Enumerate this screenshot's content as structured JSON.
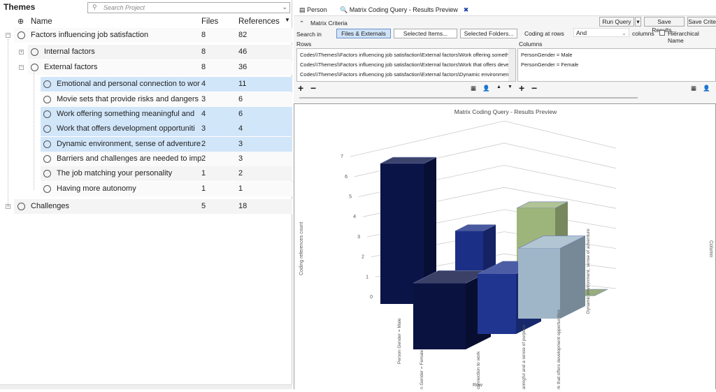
{
  "themes": {
    "title": "Themes",
    "search_placeholder": "Search Project",
    "columns": {
      "name": "Name",
      "files": "Files",
      "references": "References"
    },
    "rows": [
      {
        "name": "Factors influencing job satisfaction",
        "files": "8",
        "references": "82",
        "level": 0,
        "expander": "minus",
        "selected": false
      },
      {
        "name": "Internal factors",
        "files": "8",
        "references": "46",
        "level": 1,
        "expander": "plus",
        "selected": false
      },
      {
        "name": "External factors",
        "files": "8",
        "references": "36",
        "level": 1,
        "expander": "minus",
        "selected": false
      },
      {
        "name": "Emotional and personal connection to wor",
        "files": "4",
        "references": "11",
        "level": 2,
        "selected": true
      },
      {
        "name": "Movie sets that provide risks and dangers",
        "files": "3",
        "references": "6",
        "level": 2,
        "selected": false
      },
      {
        "name": "Work offering something meaningful and",
        "files": "4",
        "references": "6",
        "level": 2,
        "selected": true
      },
      {
        "name": "Work that offers development opportuniti",
        "files": "3",
        "references": "4",
        "level": 2,
        "selected": true
      },
      {
        "name": "Dynamic environment, sense of adventure",
        "files": "2",
        "references": "3",
        "level": 2,
        "selected": true
      },
      {
        "name": "Barriers and challenges are needed to imp",
        "files": "2",
        "references": "3",
        "level": 2,
        "selected": false
      },
      {
        "name": "The job matching your personality",
        "files": "1",
        "references": "2",
        "level": 2,
        "selected": false
      },
      {
        "name": "Having more autonomy",
        "files": "1",
        "references": "1",
        "level": 2,
        "selected": false
      },
      {
        "name": "Challenges",
        "files": "5",
        "references": "18",
        "level": 0,
        "expander": "plus",
        "selected": false
      }
    ]
  },
  "tabs": [
    {
      "label": "Person"
    },
    {
      "label": "Matrix Coding Query - Results Preview"
    }
  ],
  "criteria": {
    "section": "Matrix Criteria",
    "run_query": "Run Query",
    "save_results": "Save Results...",
    "save_criteria": "Save Criter",
    "search_in": "Search in",
    "files_externals": "Files & Externals",
    "selected_items": "Selected Items...",
    "selected_folders": "Selected Folders...",
    "coding_at_rows": "Coding at rows",
    "operator": "And",
    "columns_label": "columns",
    "hierarchical_name": "Hierarchical Name",
    "rows_label": "Rows",
    "columns_header": "Columns",
    "rows": [
      "Codes\\\\Themes\\\\Factors influencing job satisfaction\\External factors\\Work offering somethi",
      "Codes\\\\Themes\\\\Factors influencing job satisfaction\\External factors\\Work that offers devel",
      "Codes\\\\Themes\\\\Factors influencing job satisfaction\\External factors\\Dynamic environment,"
    ],
    "columns": [
      "PersonGender = Male",
      "PersonGender = Female"
    ]
  },
  "chart_data": {
    "type": "bar",
    "title": "Matrix Coding Query - Results Preview",
    "ylabel": "Coding references count",
    "xlabel": "Row",
    "zlabel": "Column",
    "ylim": [
      0,
      7
    ],
    "yticks": [
      "0",
      "1",
      "2",
      "3",
      "4",
      "5",
      "6",
      "7"
    ],
    "tick_labels": [
      "Person Gender = Male",
      "n Gender = Female",
      "connection to work",
      "aningful and a sense of purpose",
      "rk that offers development opportunities",
      "Dynamic environment, sense of adventure"
    ],
    "series": [
      {
        "values": [
          7,
          3.5,
          4.5,
          0
        ],
        "colors": [
          "#0b1447",
          "#1c2f86",
          "#9db57a",
          "#7e9a5e"
        ]
      },
      {
        "values": [
          3.3,
          3,
          3.5
        ],
        "colors": [
          "#0a1240",
          "#1f3590",
          "#9fb6c8"
        ]
      }
    ]
  }
}
